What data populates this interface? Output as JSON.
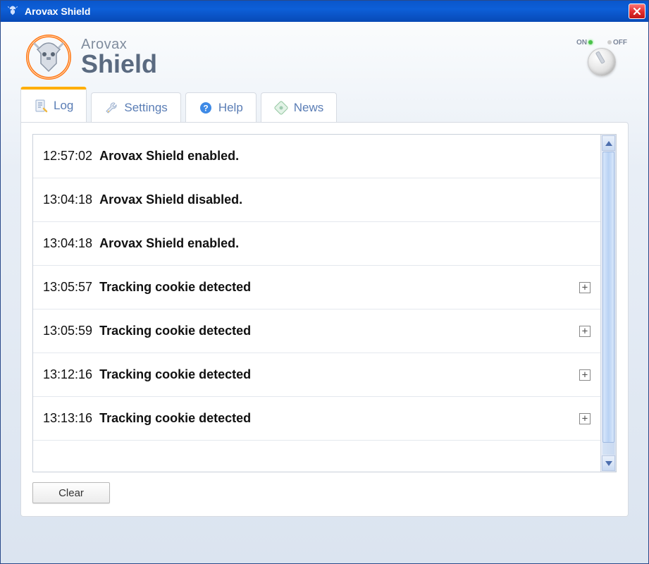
{
  "window": {
    "title": "Arovax Shield"
  },
  "brand": {
    "line1": "Arovax",
    "line2": "Shield"
  },
  "toggle": {
    "on_label": "ON",
    "off_label": "OFF",
    "state": "on"
  },
  "tabs": [
    {
      "id": "log",
      "label": "Log",
      "icon": "log-icon",
      "active": true
    },
    {
      "id": "settings",
      "label": "Settings",
      "icon": "wrench-icon",
      "active": false
    },
    {
      "id": "help",
      "label": "Help",
      "icon": "help-icon",
      "active": false
    },
    {
      "id": "news",
      "label": "News",
      "icon": "news-icon",
      "active": false
    }
  ],
  "log": {
    "entries": [
      {
        "time": "12:57:02",
        "message": "Arovax Shield enabled.",
        "expandable": false
      },
      {
        "time": "13:04:18",
        "message": "Arovax Shield disabled.",
        "expandable": false
      },
      {
        "time": "13:04:18",
        "message": "Arovax Shield enabled.",
        "expandable": false
      },
      {
        "time": "13:05:57",
        "message": "Tracking cookie detected",
        "expandable": true
      },
      {
        "time": "13:05:59",
        "message": "Tracking cookie detected",
        "expandable": true
      },
      {
        "time": "13:12:16",
        "message": "Tracking cookie detected",
        "expandable": true
      },
      {
        "time": "13:13:16",
        "message": "Tracking cookie detected",
        "expandable": true
      }
    ]
  },
  "buttons": {
    "clear": "Clear"
  }
}
